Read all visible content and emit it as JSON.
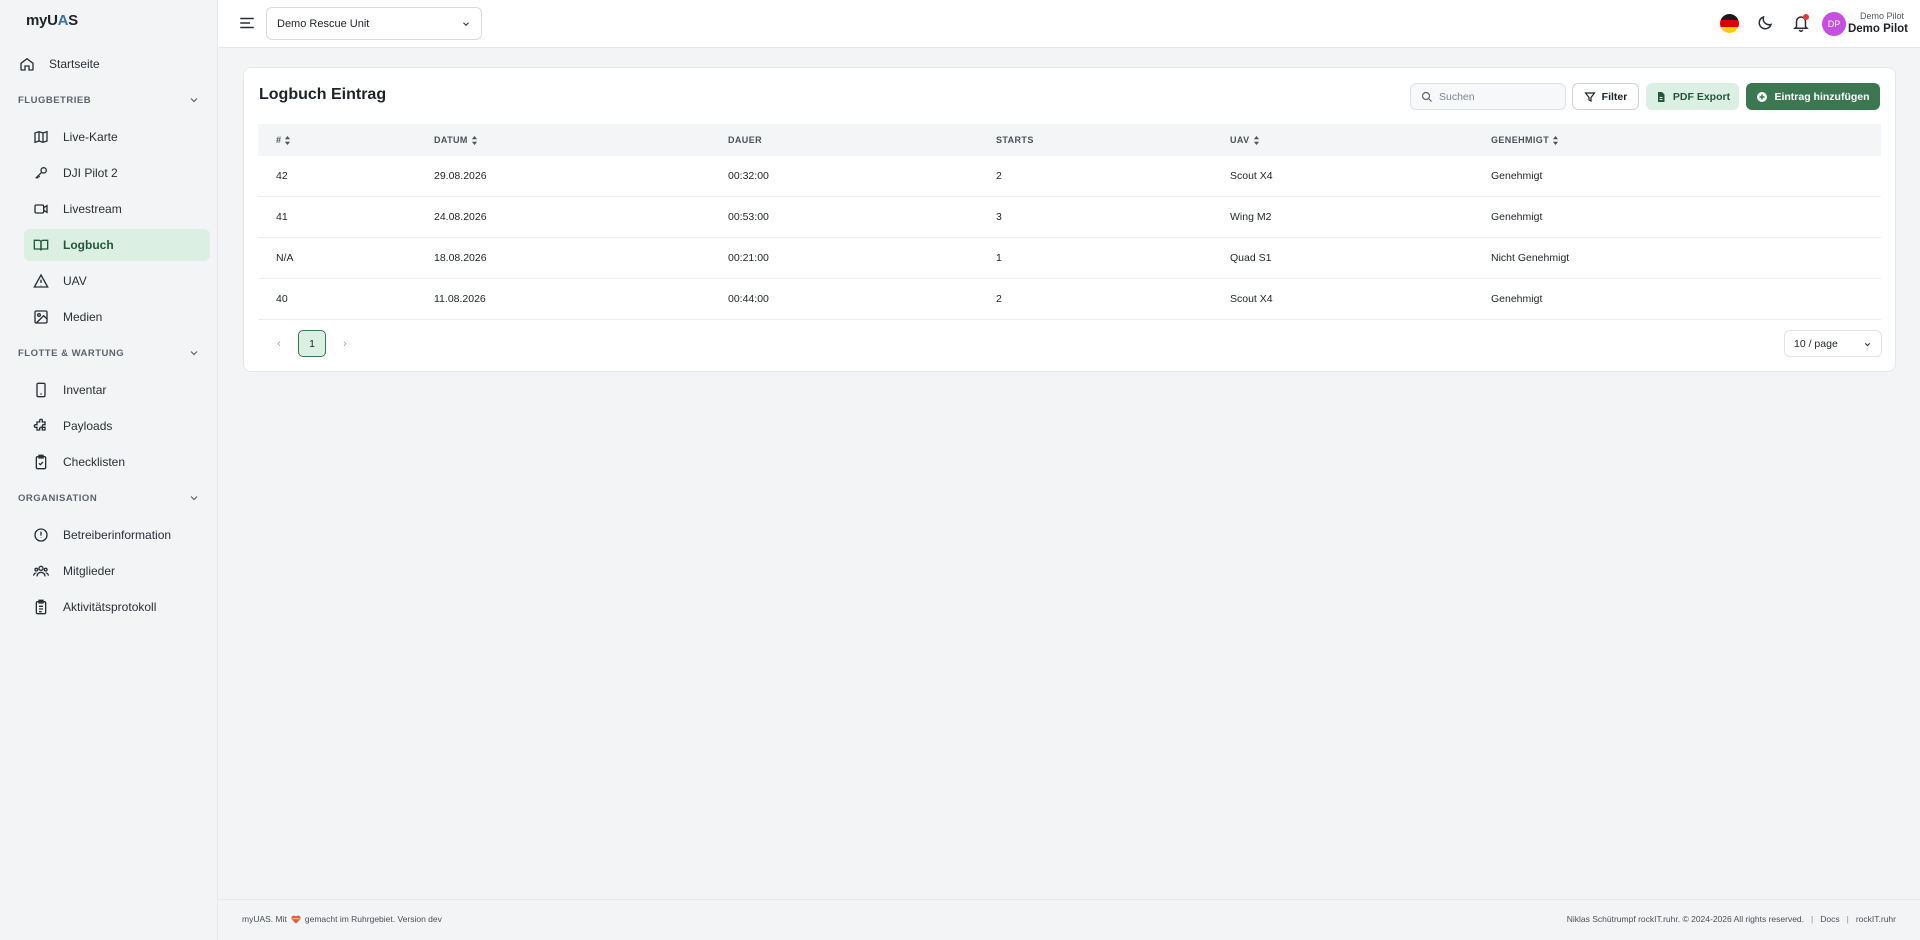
{
  "app": {
    "logo_prefix": "myU",
    "logo_accent": "A",
    "logo_suffix": "S"
  },
  "sidebar": {
    "home": "Startseite",
    "sections": [
      {
        "title": "FLUGBETRIEB",
        "items": [
          "Live-Karte",
          "DJI Pilot 2",
          "Livestream",
          "Logbuch",
          "UAV",
          "Medien"
        ]
      },
      {
        "title": "FLOTTE & WARTUNG",
        "items": [
          "Inventar",
          "Payloads",
          "Checklisten"
        ]
      },
      {
        "title": "ORGANISATION",
        "items": [
          "Betreiberinformation",
          "Mitglieder",
          "Aktivitätsprotokoll"
        ]
      }
    ],
    "active_item": "Logbuch"
  },
  "topbar": {
    "unit_select_value": "Demo Rescue Unit",
    "avatar_initials": "DP",
    "user_name_small": "Demo Pilot",
    "user_name_big": "Demo Pilot"
  },
  "card": {
    "title": "Logbuch Eintrag",
    "search_placeholder": "Suchen",
    "filter_label": "Filter",
    "pdf_label": "PDF Export",
    "add_label": "Eintrag hinzufügen"
  },
  "table": {
    "headers": [
      "#",
      "DATUM",
      "DAUER",
      "STARTS",
      "UAV",
      "GENEHMIGT"
    ],
    "rows": [
      [
        "42",
        "29.08.2026",
        "00:32:00",
        "2",
        "Scout X4",
        "Genehmigt"
      ],
      [
        "41",
        "24.08.2026",
        "00:53:00",
        "3",
        "Wing M2",
        "Genehmigt"
      ],
      [
        "N/A",
        "18.08.2026",
        "00:21:00",
        "1",
        "Quad S1",
        "Nicht Genehmigt"
      ],
      [
        "40",
        "11.08.2026",
        "00:44:00",
        "2",
        "Scout X4",
        "Genehmigt"
      ]
    ]
  },
  "pagination": {
    "prev": "‹",
    "current": "1",
    "next": "›",
    "page_size": "10 / page"
  },
  "footer": {
    "left_before": "myUAS. Mit",
    "left_after": "gemacht im Ruhrgebiet. Version dev",
    "copyright": "Niklas Schütrumpf rockIT.ruhr. © 2024-2026 All rights reserved.",
    "docs": "Docs",
    "rockit": "rockIT.ruhr"
  },
  "colors": {
    "accent": "#3b7852",
    "accent_light": "#dcefe3",
    "avatar": "#c64fe0"
  }
}
